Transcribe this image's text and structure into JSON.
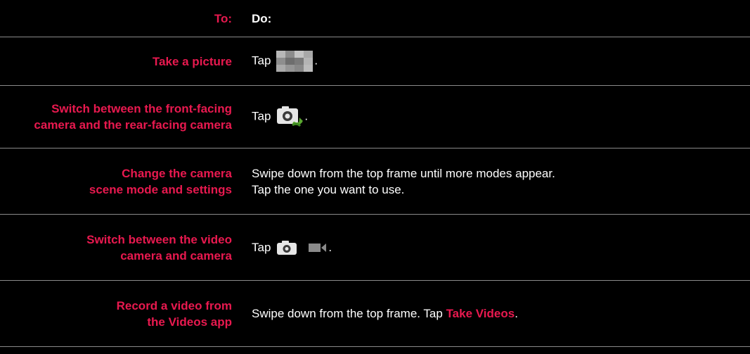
{
  "header": {
    "to_label": "To:",
    "do_label": "Do:"
  },
  "rows": [
    {
      "to_lines": [
        "Take a picture"
      ],
      "do_prefix": "Tap",
      "icon": "shutter-button-icon",
      "do_suffix": "."
    },
    {
      "to_lines": [
        "Switch between the front-facing",
        "camera and the rear-facing camera"
      ],
      "do_prefix": "Tap",
      "icon": "switch-camera-icon",
      "do_suffix": "."
    },
    {
      "to_lines": [
        "Change the camera",
        "scene mode and settings"
      ],
      "do_lines": [
        "Swipe down from the top frame until more modes appear.",
        "Tap the one you want to use."
      ]
    },
    {
      "to_lines": [
        "Switch between the video",
        "camera and camera"
      ],
      "do_prefix": "Tap",
      "icons": [
        "camera-mode-icon",
        "video-mode-icon"
      ],
      "do_suffix": "."
    },
    {
      "to_lines": [
        "Record a video from",
        "the Videos app"
      ],
      "do_prefix": "Swipe down from the top frame. Tap",
      "do_link": "Take Videos",
      "do_suffix": "."
    }
  ],
  "colors": {
    "accent": "#e8194f",
    "text": "#ffffff",
    "background": "#000000",
    "divider": "#8a8a8a"
  }
}
